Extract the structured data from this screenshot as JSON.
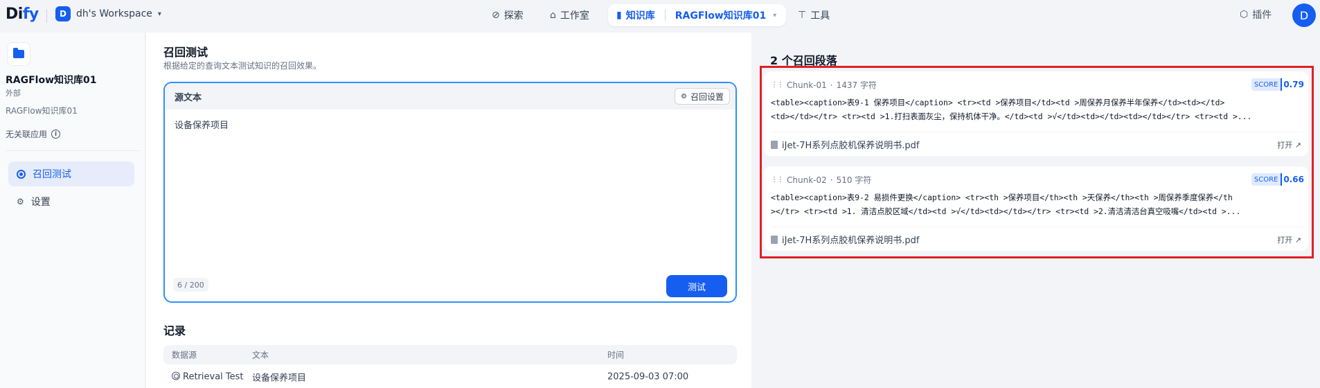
{
  "topbar": {
    "logo_main": "Di",
    "logo_accent": "fy",
    "workspace_initial": "D",
    "workspace_name": "dh's Workspace",
    "nav": {
      "explore": "探索",
      "studio": "工作室",
      "knowledge": "知识库",
      "current_kb": "RAGFlow知识库01",
      "tools": "工具"
    },
    "plugins": "插件",
    "user_initial": "D"
  },
  "sidebar": {
    "kb_name": "RAGFlow知识库01",
    "kb_type": "外部",
    "kb_desc": "RAGFlow知识库01",
    "linked_apps": "无关联应用",
    "items": [
      {
        "label": "召回测试",
        "active": true
      },
      {
        "label": "设置",
        "active": false
      }
    ]
  },
  "retrieval": {
    "title": "召回测试",
    "subtitle": "根据给定的查询文本测试知识的召回效果。",
    "source_label": "源文本",
    "settings_button": "召回设置",
    "query_text": "设备保养项目",
    "char_count": "6 / 200",
    "test_button": "测试"
  },
  "records": {
    "title": "记录",
    "columns": [
      "数据源",
      "文本",
      "时间"
    ],
    "rows": [
      {
        "source": "Retrieval Test",
        "text": "设备保养项目",
        "time": "2025-09-03 07:00"
      }
    ]
  },
  "results": {
    "title": "2 个召回段落",
    "chunks": [
      {
        "id": "Chunk-01",
        "chars": "1437 字符",
        "score_label": "SCORE",
        "score": "0.79",
        "line1": "<table><caption>表9-1 保养项目</caption> <tr><td >保养项目</td><td >周保养月保养半年保养</td><td></td>",
        "line2": "<td></td></tr> <tr><td >1.打扫表面灰尘，保持机体干净。</td><td >√</td><td></td><td></td></tr> <tr><td >...",
        "file": "iJet-7H系列点胶机保养说明书.pdf",
        "open": "打开"
      },
      {
        "id": "Chunk-02",
        "chars": "510 字符",
        "score_label": "SCORE",
        "score": "0.66",
        "line1": "<table><caption>表9-2 易损件更换</caption> <tr><th >保养项目</th><th >天保养</th><th >周保养季度保养</th",
        "line2": "></tr> <tr><td >1. 清洁点胶区域</td><td >√</td><td></td></tr> <tr><td >2.清洁清洁台真空吸嘴</td><td >...",
        "file": "iJet-7H系列点胶机保养说明书.pdf",
        "open": "打开"
      }
    ]
  }
}
